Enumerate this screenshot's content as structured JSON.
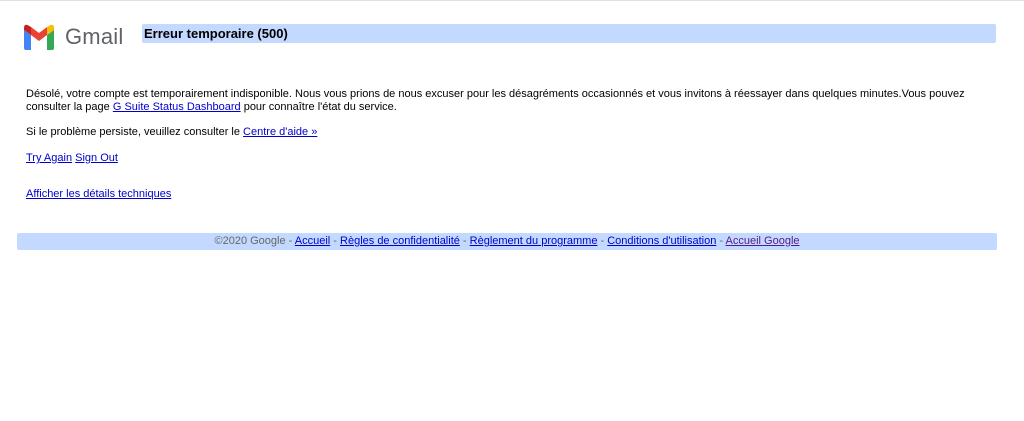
{
  "logo": {
    "text": "Gmail",
    "icon": "gmail-m-icon",
    "colors": {
      "blue": "#4285F4",
      "green": "#34A853",
      "yellow": "#FBBC04",
      "red": "#EA4335",
      "darkred": "#C5221F"
    }
  },
  "error": {
    "title": "Erreur temporaire (500)"
  },
  "message": {
    "text_before_link": "Désolé, votre compte est temporairement indisponible. Nous vous prions de nous excuser pour les désagréments occasionnés et vous invitons à réessayer dans quelques minutes.Vous pouvez consulter la page ",
    "status_link": "G Suite Status Dashboard",
    "text_after_link": " pour connaître l'état du service.",
    "help_prefix": "Si le problème persiste, veuillez consulter le ",
    "help_link": "Centre d'aide »"
  },
  "actions": {
    "try_again": "Try Again",
    "sign_out": "Sign Out",
    "tech_details": "Afficher les détails techniques"
  },
  "footer": {
    "copyright": "©2020 Google",
    "separator": " - ",
    "links": [
      "Accueil",
      "Règles de confidentialité",
      "Règlement du programme",
      "Conditions d'utilisation",
      "Accueil Google"
    ]
  },
  "colors": {
    "bar_background": "#c3d9ff",
    "link": "#0000cc",
    "visited_link": "#551a8b",
    "footer_text": "#676767"
  }
}
